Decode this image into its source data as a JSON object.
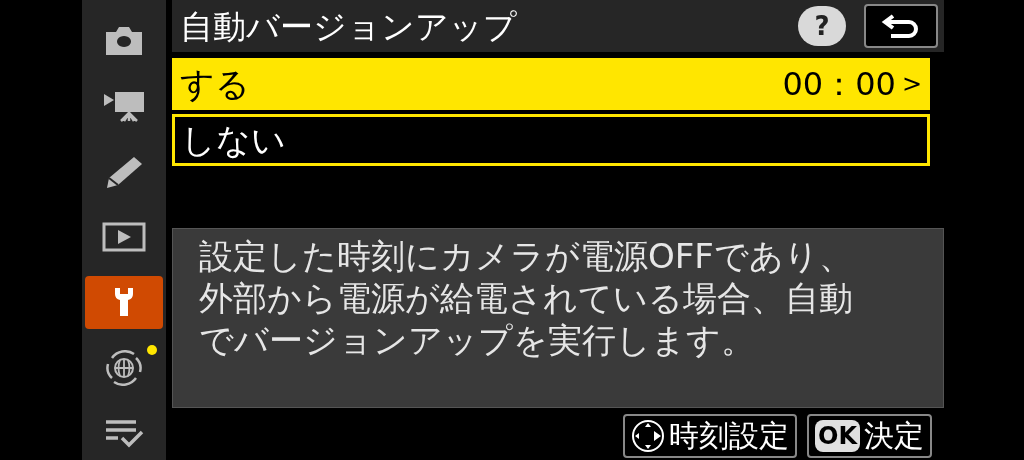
{
  "sidebar": {
    "items": [
      {
        "kind": "camera",
        "selected": false,
        "notification": false
      },
      {
        "kind": "movie",
        "selected": false,
        "notification": false
      },
      {
        "kind": "pencil",
        "selected": false,
        "notification": false
      },
      {
        "kind": "playback",
        "selected": false,
        "notification": false
      },
      {
        "kind": "wrench",
        "selected": true,
        "notification": false
      },
      {
        "kind": "network",
        "selected": false,
        "notification": true
      },
      {
        "kind": "mymenu",
        "selected": false,
        "notification": false
      }
    ]
  },
  "header": {
    "title": "自動バージョンアップ",
    "help": "?"
  },
  "options": [
    {
      "label": "する",
      "value": "00：00",
      "arrow": ">",
      "selected": true
    },
    {
      "label": "しない",
      "selected": false
    }
  ],
  "help_text": "設定した時刻にカメラが電源OFFであり、外部から電源が給電されている場合、自動でバージョンアップを実行します。",
  "footer": [
    {
      "kind": "multi",
      "label": "時刻設定"
    },
    {
      "kind": "ok",
      "badge": "OK",
      "label": "決定"
    }
  ]
}
